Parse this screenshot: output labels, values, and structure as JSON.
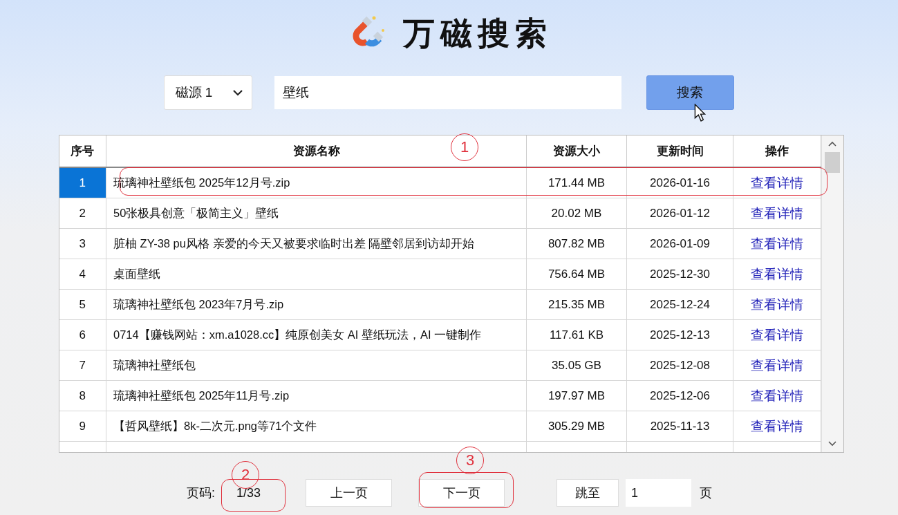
{
  "header": {
    "title": "万磁搜索"
  },
  "search": {
    "source": "磁源 1",
    "value": "壁纸",
    "button": "搜索"
  },
  "table": {
    "columns": [
      "序号",
      "资源名称",
      "资源大小",
      "更新时间",
      "操作"
    ],
    "rows": [
      {
        "index": "1",
        "name": "琉璃神社壁纸包 2025年12月号.zip",
        "size": "171.44 MB",
        "updated": "2026-01-16",
        "action": "查看详情",
        "selected": true
      },
      {
        "index": "2",
        "name": "50张极具创意「极简主义」壁纸",
        "size": "20.02 MB",
        "updated": "2026-01-12",
        "action": "查看详情",
        "selected": false
      },
      {
        "index": "3",
        "name": "脏柚 ZY-38 pu风格 亲爱的今天又被要求临时出差 隔壁邻居到访却开始",
        "size": "807.82 MB",
        "updated": "2026-01-09",
        "action": "查看详情",
        "selected": false
      },
      {
        "index": "4",
        "name": "桌面壁纸",
        "size": "756.64 MB",
        "updated": "2025-12-30",
        "action": "查看详情",
        "selected": false
      },
      {
        "index": "5",
        "name": "琉璃神社壁纸包 2023年7月号.zip",
        "size": "215.35 MB",
        "updated": "2025-12-24",
        "action": "查看详情",
        "selected": false
      },
      {
        "index": "6",
        "name": "0714【赚钱网站：xm.a1028.cc】纯原创美女 AI 壁纸玩法，AI 一键制作",
        "size": "117.61 KB",
        "updated": "2025-12-13",
        "action": "查看详情",
        "selected": false
      },
      {
        "index": "7",
        "name": "琉璃神社壁纸包",
        "size": "35.05 GB",
        "updated": "2025-12-08",
        "action": "查看详情",
        "selected": false
      },
      {
        "index": "8",
        "name": "琉璃神社壁纸包 2025年11月号.zip",
        "size": "197.97 MB",
        "updated": "2025-12-06",
        "action": "查看详情",
        "selected": false
      },
      {
        "index": "9",
        "name": "【哲风壁纸】8k-二次元.png等71个文件",
        "size": "305.29 MB",
        "updated": "2025-11-13",
        "action": "查看详情",
        "selected": false
      }
    ]
  },
  "pager": {
    "label": "页码:",
    "page": "1/33",
    "prev": "上一页",
    "next": "下一页",
    "jump": "跳至",
    "jump_value": "1",
    "unit": "页"
  },
  "annotations": [
    {
      "kind": "circle",
      "label": "1"
    },
    {
      "kind": "outline"
    },
    {
      "kind": "circle",
      "label": "2"
    },
    {
      "kind": "outline"
    },
    {
      "kind": "circle",
      "label": "3"
    },
    {
      "kind": "outline"
    }
  ]
}
